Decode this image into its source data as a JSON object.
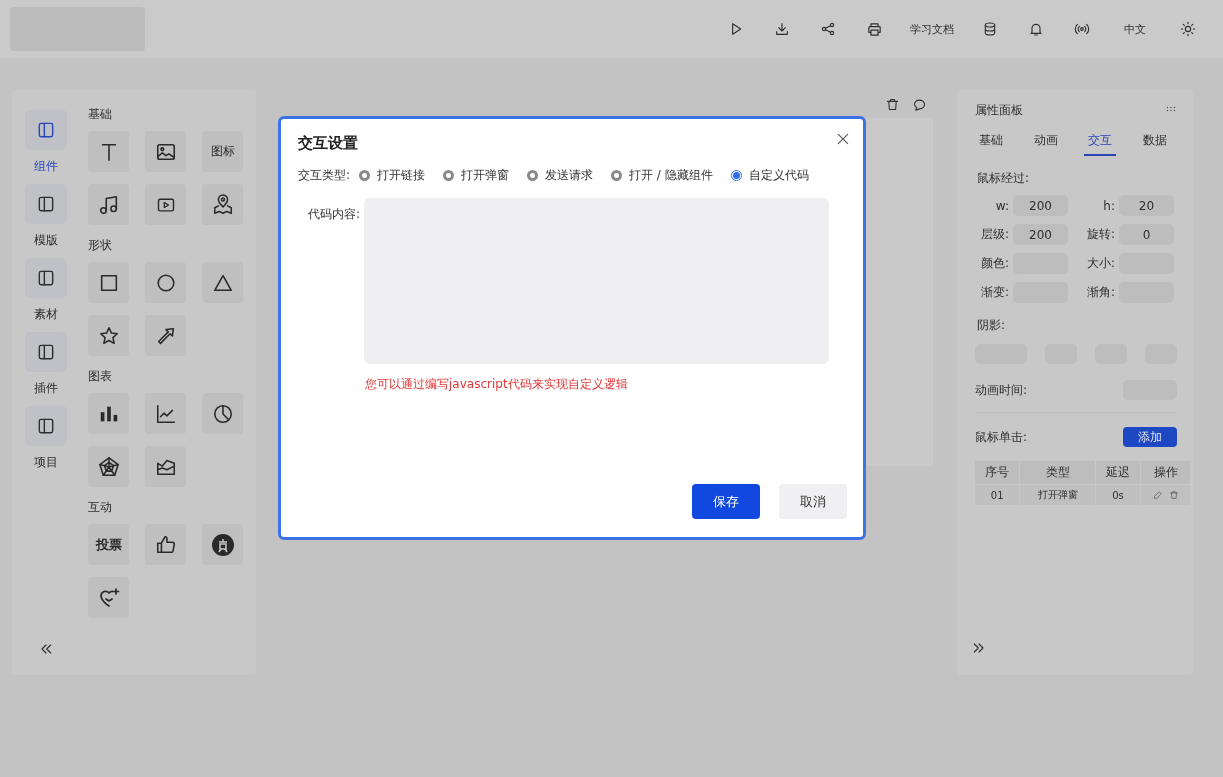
{
  "top_bar": {
    "items": [
      {
        "kind": "icon"
      },
      {
        "kind": "icon"
      },
      {
        "kind": "icon"
      },
      {
        "kind": "icon"
      },
      {
        "kind": "text",
        "label": "学习文档"
      },
      {
        "kind": "icon"
      },
      {
        "kind": "icon"
      },
      {
        "kind": "icon"
      },
      {
        "kind": "text",
        "label": "中文"
      },
      {
        "kind": "icon"
      }
    ]
  },
  "left_nav": {
    "items": [
      {
        "label": "组件",
        "selected": true
      },
      {
        "label": "模版",
        "selected": false
      },
      {
        "label": "素材",
        "selected": false
      },
      {
        "label": "插件",
        "selected": false
      },
      {
        "label": "项目",
        "selected": false
      }
    ]
  },
  "component_groups": [
    {
      "title": "基础",
      "items": [
        {
          "kind": "icon"
        },
        {
          "kind": "icon"
        },
        {
          "kind": "text",
          "label": "图标"
        },
        {
          "kind": "icon"
        },
        {
          "kind": "icon"
        },
        {
          "kind": "icon"
        }
      ]
    },
    {
      "title": "形状",
      "items": [
        {
          "kind": "icon"
        },
        {
          "kind": "icon"
        },
        {
          "kind": "icon"
        },
        {
          "kind": "icon"
        },
        {
          "kind": "icon"
        }
      ]
    },
    {
      "title": "图表",
      "items": [
        {
          "kind": "icon"
        },
        {
          "kind": "icon"
        },
        {
          "kind": "icon"
        },
        {
          "kind": "icon"
        },
        {
          "kind": "icon"
        }
      ]
    },
    {
      "title": "互动",
      "items": [
        {
          "kind": "text",
          "label": "投票"
        },
        {
          "kind": "icon"
        },
        {
          "kind": "icon"
        },
        {
          "kind": "icon"
        }
      ]
    }
  ],
  "dialog": {
    "title": "交互设置",
    "type_label": "交互类型:",
    "options": [
      {
        "label": "打开链接",
        "selected": false
      },
      {
        "label": "打开弹窗",
        "selected": false
      },
      {
        "label": "发送请求",
        "selected": false
      },
      {
        "label": "打开 / 隐藏组件",
        "selected": false
      },
      {
        "label": "自定义代码",
        "selected": true
      }
    ],
    "code_label": "代码内容:",
    "hint": "您可以通过编写javascript代码来实现自定义逻辑",
    "buttons": [
      {
        "label": "保存",
        "kind": "primary"
      },
      {
        "label": "取消",
        "kind": "default"
      }
    ]
  },
  "property_panel": {
    "title": "属性面板",
    "tabs": [
      {
        "label": "基础",
        "selected": false
      },
      {
        "label": "动画",
        "selected": false
      },
      {
        "label": "交互",
        "selected": true
      },
      {
        "label": "数据",
        "selected": false
      }
    ],
    "hover_label": "鼠标经过:",
    "fields": [
      {
        "label": "w:",
        "value": "200"
      },
      {
        "label": "h:",
        "value": "20"
      },
      {
        "label": "层级:",
        "value": "200"
      },
      {
        "label": "旋转:",
        "value": "0"
      },
      {
        "label": "颜色:"
      },
      {
        "label": "大小:"
      },
      {
        "label": "渐变:"
      },
      {
        "label": "渐角:"
      }
    ],
    "shadow_label": "阴影:",
    "duration_label": "动画时间:",
    "click_label": "鼠标单击:",
    "add_button": "添加",
    "table": {
      "columns": [
        "序号",
        "类型",
        "延迟",
        "操作"
      ],
      "rows": [
        {
          "cells": [
            "01",
            "打开弹窗",
            "0s"
          ]
        }
      ]
    }
  }
}
